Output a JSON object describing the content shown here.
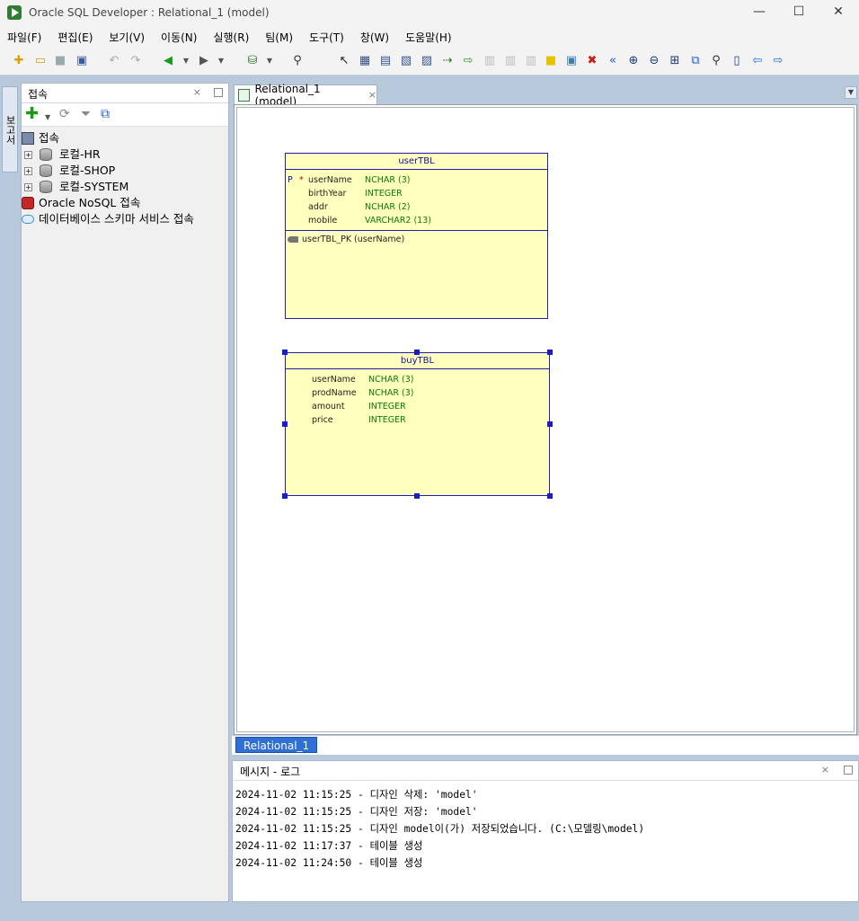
{
  "window": {
    "title": "Oracle SQL Developer : Relational_1 (model)",
    "minimize": "—",
    "maximize": "☐",
    "close": "✕"
  },
  "menu": [
    "파일(F)",
    "편집(E)",
    "보기(V)",
    "이동(N)",
    "실행(R)",
    "팀(M)",
    "도구(T)",
    "창(W)",
    "도움말(H)"
  ],
  "side_tab": {
    "label": "보고서"
  },
  "connections": {
    "title": "접속",
    "close": "×",
    "root": "접속",
    "items": [
      {
        "label": "로컬-HR",
        "expander": "+"
      },
      {
        "label": "로컬-SHOP",
        "expander": "+"
      },
      {
        "label": "로컬-SYSTEM",
        "expander": "+"
      }
    ],
    "nosql": "Oracle NoSQL 접속",
    "schema_service": "데이터베이스 스키마 서비스 접속"
  },
  "editor": {
    "tab_label": "Relational_1 (model)",
    "tab_close": "×"
  },
  "diagram": {
    "usertbl": {
      "name": "userTBL",
      "columns": [
        {
          "pk": "P",
          "req": "*",
          "name": "userName",
          "type": "NCHAR (3)"
        },
        {
          "pk": "",
          "req": "",
          "name": "birthYear",
          "type": "INTEGER"
        },
        {
          "pk": "",
          "req": "",
          "name": "addr",
          "type": "NCHAR (2)"
        },
        {
          "pk": "",
          "req": "",
          "name": "mobile",
          "type": "VARCHAR2 (13)"
        }
      ],
      "constraint": "userTBL_PK (userName)"
    },
    "buytbl": {
      "name": "buyTBL",
      "columns": [
        {
          "name": "userName",
          "type": "NCHAR (3)"
        },
        {
          "name": "prodName",
          "type": "NCHAR (3)"
        },
        {
          "name": "amount",
          "type": "INTEGER"
        },
        {
          "name": "price",
          "type": "INTEGER"
        }
      ]
    }
  },
  "diagram_tab": "Relational_1",
  "log": {
    "title": "메시지 - 로그",
    "close": "×",
    "lines": [
      "2024-11-02 11:15:25 - 디자인 삭제: 'model'",
      "2024-11-02 11:15:25 - 디자인 저장: 'model'",
      "2024-11-02 11:15:25 - 디자인 model이(가) 저장되었습니다. (C:\\모델링\\model)",
      "2024-11-02 11:17:37 - 테이블 생성",
      "2024-11-02 11:24:50 - 테이블 생성"
    ]
  },
  "toolbar_icons": [
    "new-icon",
    "open-icon",
    "save-icon",
    "save-all-icon",
    "undo-icon",
    "redo-icon",
    "back-icon",
    "forward-icon",
    "sql-worksheet-icon",
    "find-icon",
    "select-icon",
    "new-table-icon",
    "new-view-icon",
    "split-table-icon",
    "merge-tables-icon",
    "new-fk-icon",
    "new-fk-1to1-icon",
    "new-arc-icon",
    "add-element-to-arc-icon",
    "remove-element-from-arc-icon",
    "new-note-icon",
    "new-picture-icon",
    "delete-icon",
    "engineer-to-logical-icon",
    "zoom-in-icon",
    "zoom-out-icon",
    "fit-screen-icon",
    "default-size-icon",
    "find-in-diagram-icon",
    "properties-icon",
    "left-arrow-icon",
    "right-arrow-icon"
  ]
}
